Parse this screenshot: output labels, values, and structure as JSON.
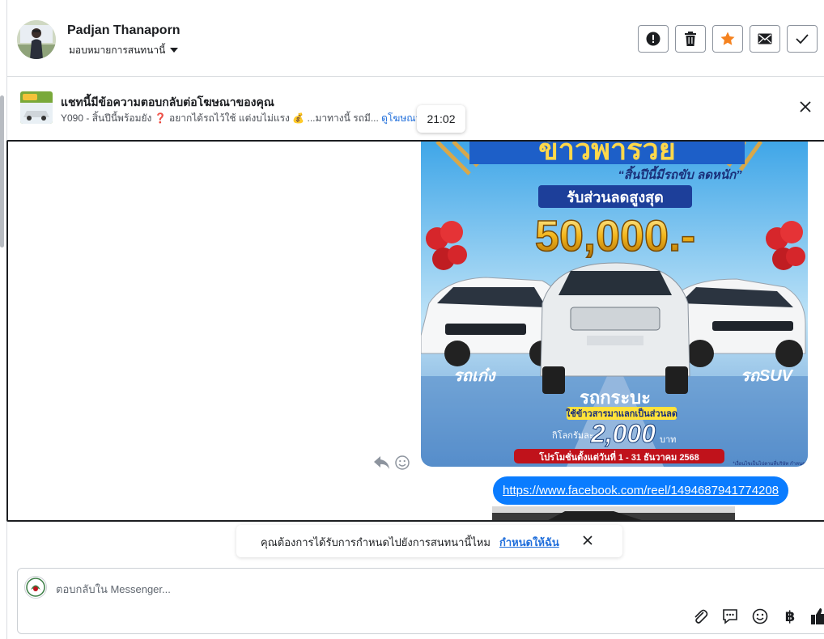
{
  "header": {
    "contact_name": "Padjan Thanaporn",
    "assign_label": "มอบหมายการสนทนานี้",
    "actions": [
      "spam-icon",
      "trash-icon",
      "star-icon",
      "envelope-icon",
      "check-icon"
    ],
    "star_color": "#f5821f"
  },
  "banner": {
    "title": "แชทนี้มีข้อความตอบกลับต่อโฆษณาของคุณ",
    "subtitle": "Y090 - สิ้นปีนี้พร้อมยัง ❓ อยากได้รถไว้ใช้ แต่งบไม่แรง 💰 ...มาทางนี้ รถมี...",
    "view_ad_link": "ดูโฆษณา"
  },
  "tooltip": {
    "time": "21:02"
  },
  "ad_image": {
    "headline": "ข้าวพารวย",
    "tagline": "“สิ้นปีนี้มีรถขับ ลดหนัก”",
    "discount_label": "รับส่วนลดสูงสุด",
    "discount_amount": "50,000.-",
    "car_left_label": "รถเก๋ง",
    "car_right_label": "รถSUV",
    "car_center_label": "รถกระบะ",
    "rice_label": "ใช้ข้าวสารมาแลกเป็นส่วนลด",
    "per_kg_label": "กิโลกรัมละ",
    "per_kg_amount": "2,000",
    "baht": "บาท",
    "promo_period": "โปรโมชั่นตั้งแต่วันที่ 1 - 31 ธันวาคม 2568",
    "fine_print": "*เงื่อนไขเป็นไปตามที่บริษัท กำหนด"
  },
  "message": {
    "link": "https://www.facebook.com/reel/1494687941774208"
  },
  "assign_prompt": {
    "question": "คุณต้องการได้รับการกำหนดไปยังการสนทนานี้ไหม",
    "action": "กำหนดให้ฉัน"
  },
  "composer": {
    "placeholder": "ตอบกลับใน Messenger...",
    "tools": [
      "paperclip-icon",
      "saved-reply-icon",
      "emoji-icon",
      "baht-icon",
      "thumbs-up-icon"
    ],
    "currency_symbol": "฿"
  },
  "colors": {
    "accent": "#0a7cff",
    "link": "#216fdb",
    "border": "#dadde1"
  }
}
